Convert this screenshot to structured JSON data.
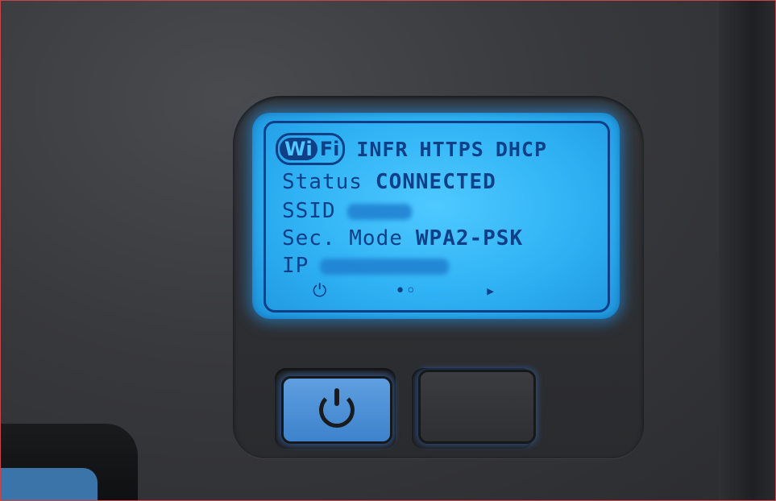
{
  "display": {
    "logo": {
      "wi": "Wi",
      "fi": "Fi"
    },
    "modes": [
      "INFR",
      "HTTPS",
      "DHCP"
    ],
    "status_label": "Status",
    "status_value": "CONNECTED",
    "ssid_label": "SSID",
    "sec_label": "Sec. Mode",
    "sec_value": "WPA2-PSK",
    "ip_label": "IP",
    "softkeys": {
      "left": "⏻",
      "middle": "•◦",
      "right": "▸"
    }
  },
  "colors": {
    "screen": "#2fb2f4",
    "text": "#0f3f87",
    "button_power": "#3d82cc",
    "body": "#38393c"
  }
}
